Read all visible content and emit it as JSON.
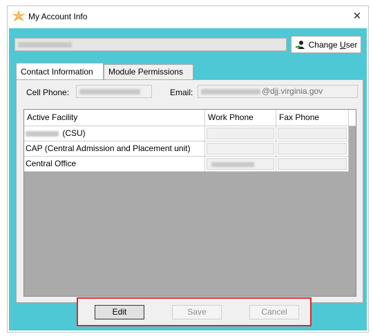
{
  "window": {
    "title": "My Account Info",
    "close_glyph": "✕"
  },
  "header": {
    "change_user_label": "Change User"
  },
  "tabs": [
    {
      "label": "Contact Information",
      "active": true
    },
    {
      "label": "Module Permissions",
      "active": false
    }
  ],
  "contact": {
    "cell_phone_label": "Cell Phone:",
    "email_label": "Email:",
    "email_domain": "@djj.virginia.gov"
  },
  "grid": {
    "columns": [
      "Active Facility",
      "Work Phone",
      "Fax Phone"
    ],
    "rows": [
      {
        "facility": "(CSU)"
      },
      {
        "facility": "CAP (Central Admission and Placement unit)"
      },
      {
        "facility": "Central Office"
      }
    ]
  },
  "buttons": {
    "edit": "Edit",
    "save": "Save",
    "cancel": "Cancel"
  },
  "colors": {
    "client_background": "#4ec8d4",
    "highlight_border": "#e0262d"
  }
}
